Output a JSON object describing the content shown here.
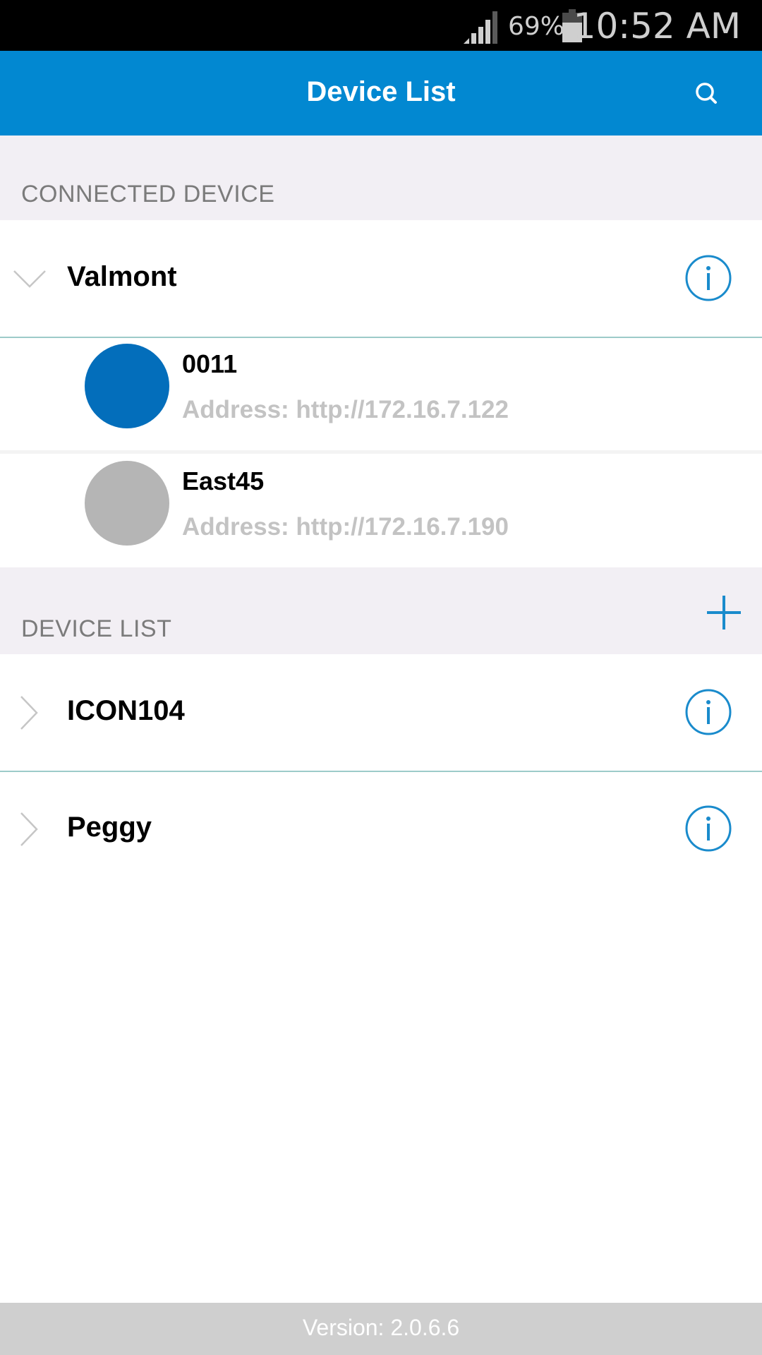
{
  "status_bar": {
    "battery_percent": "69%",
    "time": "10:52 AM",
    "battery_level": 0.69,
    "signal_bars": 4
  },
  "header": {
    "title": "Device List",
    "search_icon": "search-icon"
  },
  "connected_section": {
    "label": "CONNECTED DEVICE",
    "group": {
      "name": "Valmont",
      "expanded": true,
      "expand_icon": "chevron-down-icon",
      "info_icon": "info-icon",
      "devices": [
        {
          "name": "0011",
          "address": "Address: http://172.16.7.122",
          "status_color": "#036EBB",
          "status": "connected"
        },
        {
          "name": "East45",
          "address": "Address: http://172.16.7.190",
          "status_color": "#B5B5B5",
          "status": "disconnected"
        }
      ]
    }
  },
  "device_list_section": {
    "label": "DEVICE LIST",
    "add_icon": "plus-icon",
    "groups": [
      {
        "name": "ICON104",
        "expanded": false,
        "expand_icon": "chevron-right-icon",
        "info_icon": "info-icon"
      },
      {
        "name": "Peggy",
        "expanded": false,
        "expand_icon": "chevron-right-icon",
        "info_icon": "info-icon"
      }
    ]
  },
  "footer": {
    "version": "Version: 2.0.6.6"
  },
  "colors": {
    "primary": "#0288D1",
    "section_bg": "#F2EFF4",
    "divider": "#9CCBC9",
    "footer_bg": "#CFCFCF"
  }
}
